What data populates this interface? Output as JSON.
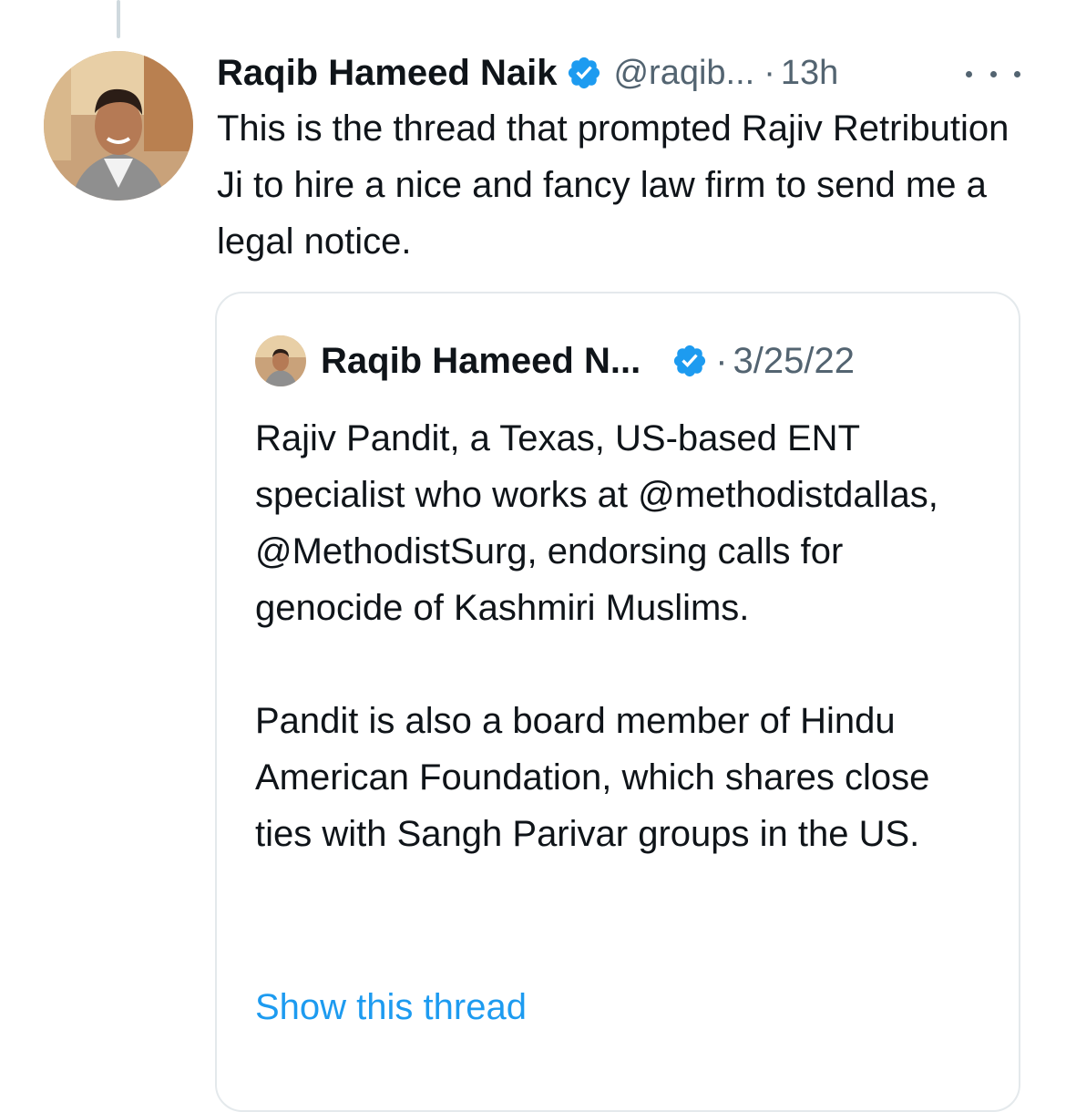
{
  "tweet": {
    "author_name": "Raqib Hameed Naik",
    "handle": "@raqib...",
    "separator": "·",
    "time": "13h",
    "text": "This is the thread that prompted Rajiv Retribution Ji to hire a nice and fancy law firm to send me a legal notice."
  },
  "quote": {
    "author_name": "Raqib Hameed N...",
    "separator": "·",
    "date": "3/25/22",
    "text": "Rajiv Pandit, a Texas, US-based ENT specialist who works at @methodistdallas, @MethodistSurg, endorsing calls for genocide of Kashmiri Muslims.\n\nPandit is also a board member of Hindu American Foundation, which shares close ties with Sangh Parivar groups in the US.",
    "show_thread_label": "Show this thread"
  },
  "colors": {
    "verified_blue": "#1d9bf0",
    "secondary_text": "#536471",
    "link": "#1d9bf0",
    "border": "#e4e9ec"
  },
  "icons": {
    "verified": "verified-badge-icon",
    "more": "more-horizontal-icon"
  }
}
